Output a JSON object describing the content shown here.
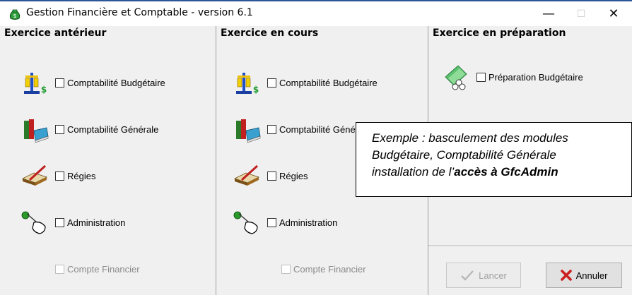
{
  "window": {
    "title": "Gestion Financière et Comptable - version 6.1",
    "minimize_glyph": "—",
    "maximize_glyph": "☐",
    "close_glyph": "✕"
  },
  "panels": {
    "previous": {
      "header": "Exercice antérieur",
      "items": [
        {
          "icon": "budget-scale-icon",
          "label": "Comptabilité Budgétaire",
          "enabled": true
        },
        {
          "icon": "books-icon",
          "label": "Comptabilité Générale",
          "enabled": true
        },
        {
          "icon": "ledger-pen-icon",
          "label": "Régies",
          "enabled": true
        },
        {
          "icon": "hand-key-icon",
          "label": "Administration",
          "enabled": true
        },
        {
          "label": "Compte Financier",
          "enabled": false
        }
      ]
    },
    "current": {
      "header": "Exercice en cours",
      "items": [
        {
          "icon": "budget-scale-icon",
          "label": "Comptabilité Budgétaire",
          "enabled": true
        },
        {
          "icon": "books-icon",
          "label": "Comptabilité Générale",
          "enabled": true
        },
        {
          "icon": "ledger-pen-icon",
          "label": "Régies",
          "enabled": true
        },
        {
          "icon": "hand-key-icon",
          "label": "Administration",
          "enabled": true
        },
        {
          "label": "Compte Financier",
          "enabled": false
        }
      ]
    },
    "preparation": {
      "header": "Exercice en préparation",
      "items": [
        {
          "icon": "money-coins-icon",
          "label": "Préparation Budgétaire",
          "enabled": true
        }
      ]
    }
  },
  "buttons": {
    "launch": {
      "label": "Lancer",
      "enabled": false,
      "icon": "check-icon"
    },
    "cancel": {
      "label": "Annuler",
      "enabled": true,
      "icon": "red-x-icon"
    }
  },
  "annotation": {
    "line1": "Exemple : basculement des modules",
    "line2": "Budgétaire, Comptabilité Générale",
    "line3_prefix": "installation de l’",
    "line3_bold": "accès à GfcAdmin"
  },
  "colors": {
    "titlebar_accent": "#2b579a",
    "window_bg": "#f0f0f0",
    "cancel_icon": "#cc1f1f"
  }
}
